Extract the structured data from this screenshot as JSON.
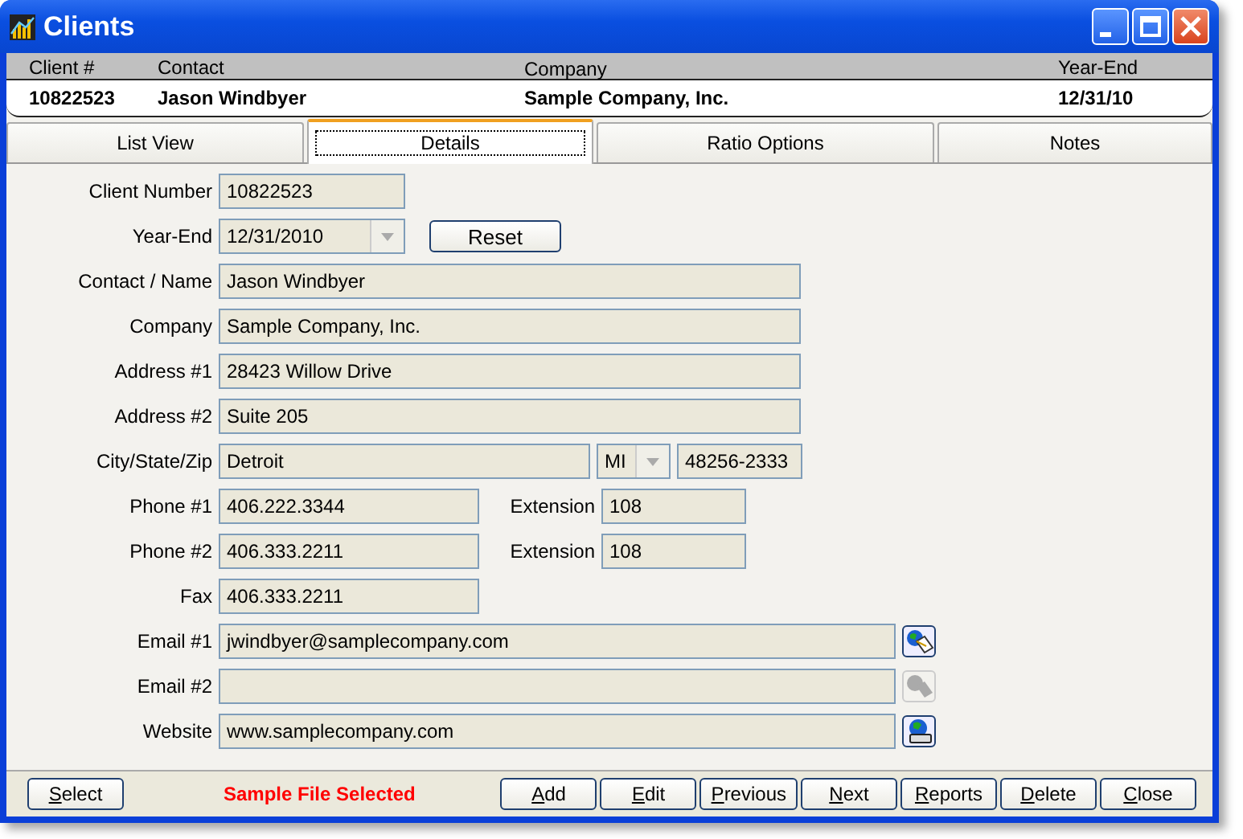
{
  "window": {
    "title": "Clients"
  },
  "summary": {
    "columns": [
      "Client #",
      "Contact",
      "Company",
      "Year-End"
    ],
    "row": [
      "10822523",
      "Jason Windbyer",
      "Sample Company, Inc.",
      "12/31/10"
    ]
  },
  "tabs": [
    {
      "label": "List View",
      "selected": false
    },
    {
      "label": "Details",
      "selected": true
    },
    {
      "label": "Ratio Options",
      "selected": false
    },
    {
      "label": "Notes",
      "selected": false
    }
  ],
  "details": {
    "client_number": {
      "label": "Client Number",
      "value": "10822523"
    },
    "year_end": {
      "label": "Year-End",
      "value": "12/31/2010",
      "reset": "Reset"
    },
    "contact": {
      "label": "Contact / Name",
      "value": "Jason Windbyer"
    },
    "company": {
      "label": "Company",
      "value": "Sample Company, Inc."
    },
    "address1": {
      "label": "Address #1",
      "value": "28423 Willow Drive"
    },
    "address2": {
      "label": "Address #2",
      "value": "Suite 205"
    },
    "city_state_zip": {
      "label": "City/State/Zip",
      "city": "Detroit",
      "state": "MI",
      "zip": "48256-2333"
    },
    "phones": [
      {
        "label": "Phone #1",
        "value": "406.222.3344",
        "extension_label": "Extension",
        "extension": "108"
      },
      {
        "label": "Phone #2",
        "value": "406.333.2211",
        "extension_label": "Extension",
        "extension": "108"
      }
    ],
    "fax": {
      "label": "Fax",
      "value": "406.333.2211"
    },
    "links": [
      {
        "kind": "email",
        "label": "Email #1",
        "value": "jwindbyer@samplecompany.com",
        "enabled": true
      },
      {
        "kind": "email",
        "label": "Email #2",
        "enabled": false
      },
      {
        "kind": "web",
        "label": "Website",
        "value": "www.samplecompany.com",
        "enabled": true
      }
    ]
  },
  "footer": {
    "select": "Select",
    "status": "Sample File Selected",
    "buttons": [
      "Add",
      "Edit",
      "Previous",
      "Next",
      "Reports",
      "Delete",
      "Close"
    ]
  }
}
